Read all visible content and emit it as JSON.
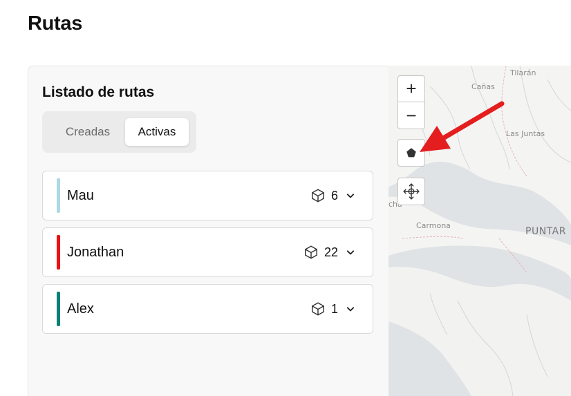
{
  "page": {
    "title": "Rutas"
  },
  "panel": {
    "title": "Listado de rutas",
    "tabs": [
      {
        "label": "Creadas",
        "active": false
      },
      {
        "label": "Activas",
        "active": true
      }
    ]
  },
  "routes": [
    {
      "name": "Mau",
      "count": "6",
      "color": "#add8e6"
    },
    {
      "name": "Jonathan",
      "count": "22",
      "color": "#ee1111"
    },
    {
      "name": "Alex",
      "count": "1",
      "color": "#0b7f7a"
    }
  ],
  "map": {
    "labels": {
      "tilaran": "Tilarán",
      "canas": "Cañas",
      "las_juntas": "Las Juntas",
      "carmona": "Carmona",
      "puntarenas": "PUNTAR",
      "cha": "cha"
    },
    "controls": {
      "zoom_in": "+",
      "zoom_out": "−"
    },
    "icons": [
      "polygon-icon",
      "move-icon"
    ]
  },
  "colors": {
    "annotation_arrow": "#e41e1e"
  }
}
